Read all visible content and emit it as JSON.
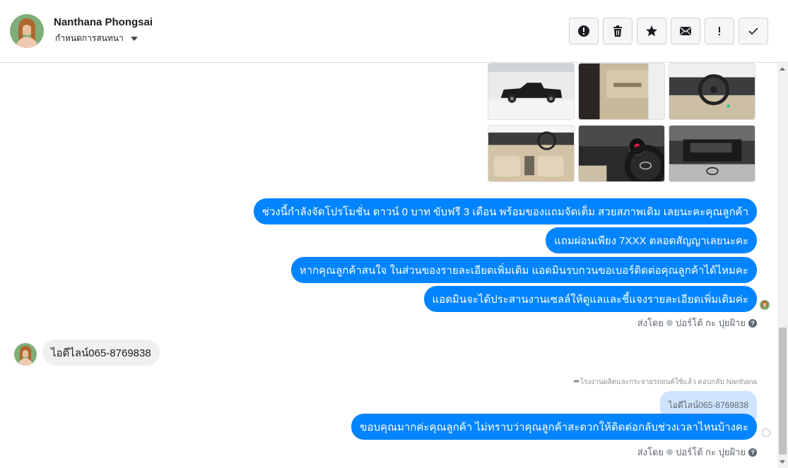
{
  "header": {
    "name": "Nanthana Phongsai",
    "subtitle": "กำหนดการสนทนา"
  },
  "toolbar": {
    "buttons": [
      {
        "icon": "alert-circle-icon",
        "label": "mark-spam"
      },
      {
        "icon": "trash-icon",
        "label": "delete"
      },
      {
        "icon": "star-icon",
        "label": "star"
      },
      {
        "icon": "envelope-icon",
        "label": "mark-unread"
      },
      {
        "icon": "exclamation-icon",
        "label": "follow-up"
      },
      {
        "icon": "check-icon",
        "label": "mark-done"
      }
    ]
  },
  "thread": {
    "photos": [
      "pickup-exterior",
      "door-interior",
      "dashboard-steering",
      "cabin-seats",
      "steering-wheel-logo",
      "engine-bay"
    ],
    "outgoing_1": [
      "ช่วงนี้กำลังจัดโปรโมชั่น ดาวน์ 0 บาท ขับฟรี 3 เดือน พร้อมของแถมจัดเต็ม สวยสภาพเดิม เลยนะคะคุณลูกค้า",
      "แถมผ่อนเพียง 7XXX ตลอดสัญญาเลยนะคะ",
      "หากคุณลูกค้าสนใจ ในส่วนของรายละเอียดเพิ่มเติม แอดมินรบกวนขอเบอร์ติดต่อคุณลูกค้าได้ไหมคะ",
      "แอดมินจะได้ประสานงานเซลล์ให้ดูแลและชี้แจงรายละเอียดเพิ่มเติมค่ะ"
    ],
    "sent_by_label": "ส่งโดย",
    "sent_by_name": "ปอร์โต้ กะ ปุยฝ้าย",
    "incoming": "ไอดีไลน์065-8769838",
    "reply_note": "โรงงานผลิตและกระจายรถยนต์ใช้แล้ว ตอบกลับ Nanthana",
    "quoted_text": "ไอดีไลน์065-8769838",
    "outgoing_2": "ขอบคุณมากค่ะคุณลูกค้า ไม่ทราบว่าคุณลูกค้าสะดวกให้ติดต่อกลับช่วงเวลาไหนบ้างคะ"
  },
  "colors": {
    "outgoing_bubble": "#0084ff",
    "incoming_bubble": "#f1f0f0",
    "quoted_bubble": "#cfe5ff"
  }
}
